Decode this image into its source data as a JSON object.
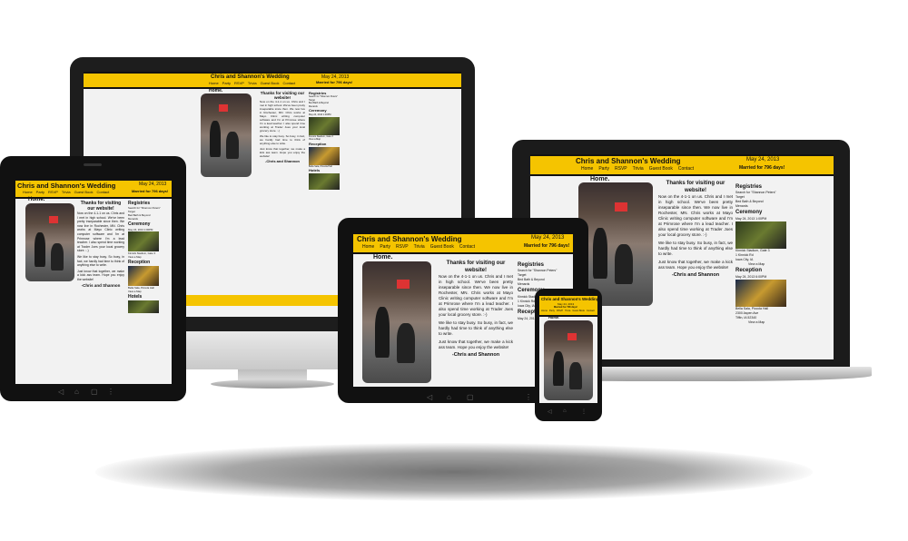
{
  "site": {
    "title": "Chris and Shannon's Wedding",
    "date": "May 24, 2013",
    "married_for": "Married for 796 days!",
    "nav": [
      "Home",
      "Party",
      "RSVP",
      "Trivia",
      "Guest Book",
      "Contact"
    ],
    "home_heading": "Home.",
    "intro_heading": "Thanks for visiting our website!",
    "intro_p1": "Now on the 4-1-1 on us. Chris and I met in high school. We've been pretty inseparable since then. We now live in Rochester, MN. Chris works at Mayo Clinic writing computer software and I'm at Primrose where I'm a lead teacher. I also spend time working at Trader Joes your local grocery store. :-)",
    "intro_p2": "We like to stay busy. So busy, in fact, we hardly had time to think of anything else to write.",
    "intro_p3": "Just know that together, we make a kick ass team. Hope you enjoy the website!",
    "signature": "-Chris and Shannon",
    "sidebar": {
      "registries_heading": "Registries",
      "registries_sub": "Search for \"Shannon Peters\"",
      "registries": [
        "Target",
        "Bed Bath & Beyond",
        "Menards"
      ],
      "ceremony_heading": "Ceremony",
      "ceremony_time": "May 24, 2013 1:00PM",
      "ceremony_place": "Kinnick Stadium, Gate 3",
      "ceremony_address": "1 Kinnick Rd",
      "ceremony_city": "Iowa City, IA",
      "view_map": "View a Map",
      "reception_heading": "Reception",
      "reception_time": "May 24, 2013 6:00PM",
      "reception_place": "Bella Sala, Piccola Hall",
      "reception_address": "2300 Aspen Ave",
      "reception_city": "Tiffin, IA 52340",
      "hotels_heading": "Hotels"
    },
    "footer": "Chris and Shannon"
  },
  "colors": {
    "header_yellow": "#f5c400",
    "device_black": "#111111",
    "page_bg": "#f2f2f2"
  }
}
